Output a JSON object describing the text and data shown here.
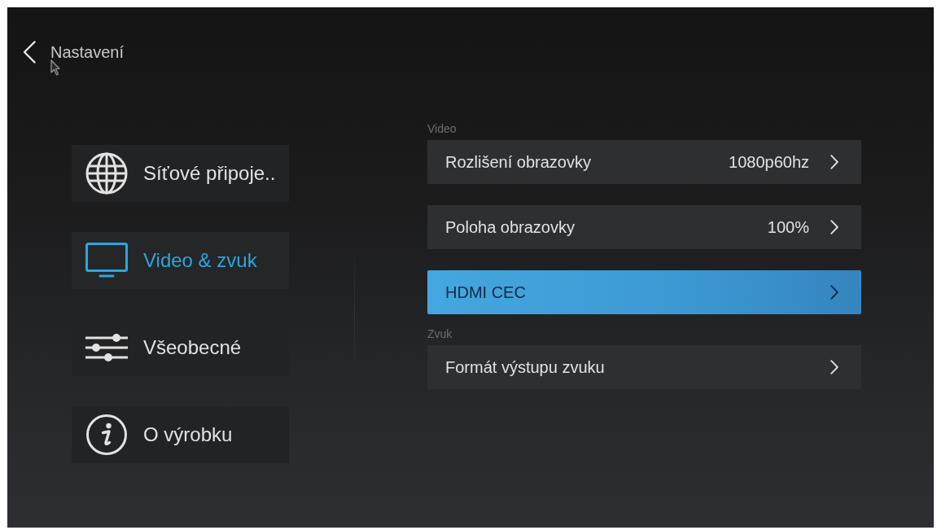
{
  "header": {
    "title": "Nastavení"
  },
  "sidebar": {
    "items": [
      {
        "label": "Síťové připoje..",
        "selected": false
      },
      {
        "label": "Video & zvuk",
        "selected": true
      },
      {
        "label": "Všeobecné",
        "selected": false
      },
      {
        "label": "O výrobku",
        "selected": false
      }
    ]
  },
  "settings": {
    "sections": [
      {
        "title": "Video",
        "rows": [
          {
            "label": "Rozlišení obrazovky",
            "value": "1080p60hz",
            "selected": false
          },
          {
            "label": "Poloha obrazovky",
            "value": "100%",
            "selected": false
          },
          {
            "label": "HDMI CEC",
            "selected": true
          }
        ]
      },
      {
        "title": "Zvuk",
        "rows": [
          {
            "label": "Formát výstupu zvuku",
            "selected": false
          }
        ]
      }
    ]
  }
}
